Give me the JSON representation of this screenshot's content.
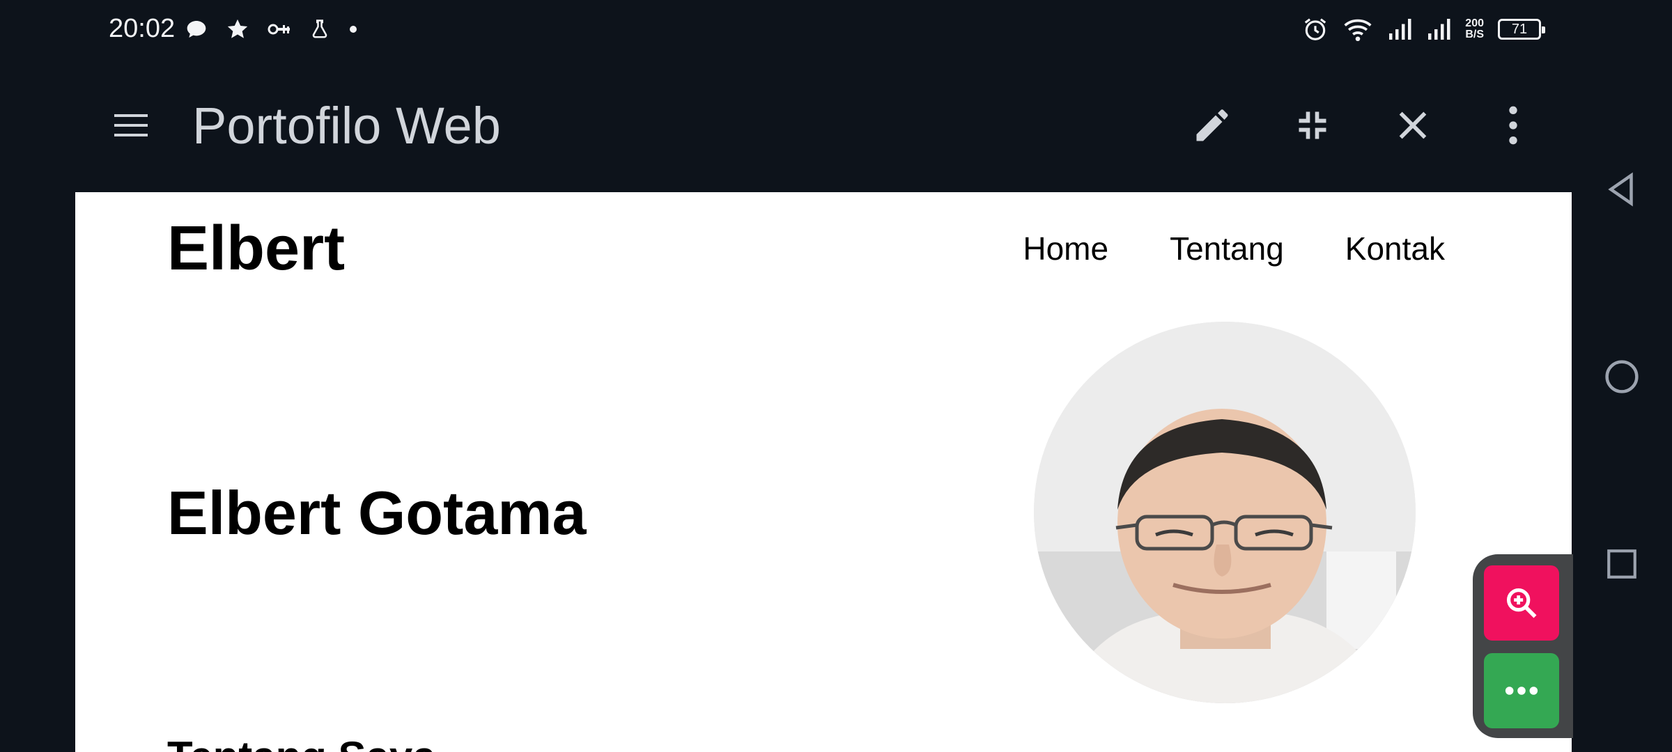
{
  "status_bar": {
    "time": "20:02",
    "left_icons": [
      "chat-bubble-icon",
      "star-icon",
      "vpn-key-icon",
      "flask-icon",
      "dot-icon"
    ],
    "right_icons": [
      "alarm-icon",
      "wifi-icon",
      "signal-icon",
      "signal-icon"
    ],
    "net_speed_value": "200",
    "net_speed_unit": "B/S",
    "battery_level": "71"
  },
  "app_bar": {
    "title": "Portofilo Web",
    "actions": [
      "edit-icon",
      "collapse-icon",
      "close-icon",
      "more-vert-icon"
    ]
  },
  "page": {
    "brand": "Elbert",
    "nav": [
      "Home",
      "Tentang",
      "Kontak"
    ],
    "hero_name": "Elbert Gotama",
    "section_title": "Tentang Saya"
  },
  "floating_tools": {
    "zoom_color": "#f0115e",
    "more_color": "#34a853"
  },
  "colors": {
    "background": "#0d131b",
    "page": "#ffffff"
  }
}
